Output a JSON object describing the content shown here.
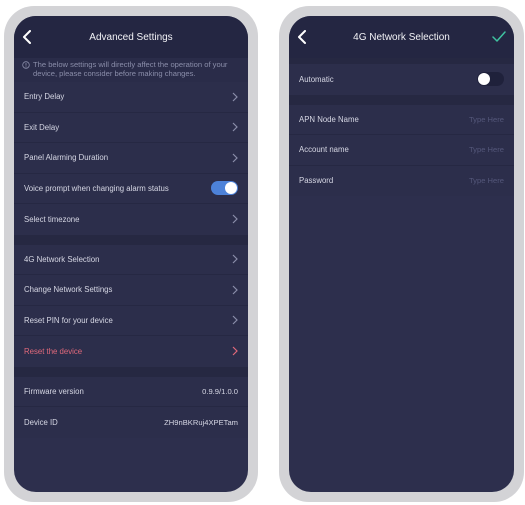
{
  "left_screen": {
    "title": "Advanced Settings",
    "notice": "The below settings will directly affect the operation of your device, please consider before making changes.",
    "group1": [
      {
        "label": "Entry Delay"
      },
      {
        "label": "Exit Delay"
      },
      {
        "label": "Panel Alarming Duration"
      },
      {
        "label": "Voice prompt when changing alarm status",
        "toggle": "on"
      },
      {
        "label": "Select timezone"
      }
    ],
    "group2": [
      {
        "label": "4G Network Selection"
      },
      {
        "label": "Change Network Settings"
      },
      {
        "label": "Reset PIN for your device"
      },
      {
        "label": "Reset the device",
        "color": "#e0697b"
      }
    ],
    "group3": [
      {
        "label": "Firmware version",
        "value": "0.9.9/1.0.0"
      },
      {
        "label": "Device ID",
        "value": "ZH9nBKRuj4XPETam"
      }
    ]
  },
  "right_screen": {
    "title": "4G Network Selection",
    "automatic": {
      "label": "Automatic",
      "toggle": "off"
    },
    "fields": [
      {
        "label": "APN Node Name",
        "placeholder": "Type Here"
      },
      {
        "label": "Account name",
        "placeholder": "Type Here"
      },
      {
        "label": "Password",
        "placeholder": "Type Here"
      }
    ]
  },
  "colors": {
    "background": "#2d2f4d",
    "navbar": "#242642",
    "accent": "#4d82d9",
    "danger": "#e0697b",
    "confirm": "#3fc2a0"
  }
}
